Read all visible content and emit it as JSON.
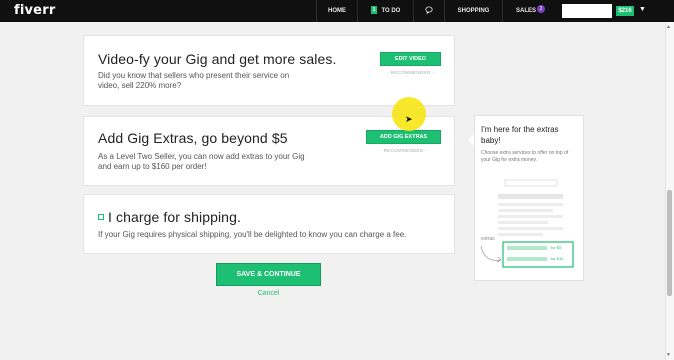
{
  "nav": {
    "logo": "fiverr",
    "home": "HOME",
    "todo_badge": "1",
    "todo": "TO DO",
    "shopping": "SHOPPING",
    "sales": "SALES",
    "sales_badge": "2",
    "balance": "$216"
  },
  "cards": {
    "video": {
      "title": "Video-fy your Gig and get more sales.",
      "body": "Did you know that sellers who present their service on video, sell 220% more?",
      "button": "EDIT VIDEO",
      "recommended": "- RECOMMENDED -"
    },
    "extras": {
      "title": "Add Gig Extras, go beyond $5",
      "body": "As a Level Two Seller, you can now add extras to your Gig and earn up to $160 per order!",
      "button": "ADD GIG EXTRAS",
      "recommended": "- RECOMMENDED -"
    },
    "shipping": {
      "title": "I charge for shipping.",
      "body": "If your Gig requires physical shipping, you'll be delighted to know you can charge a fee."
    }
  },
  "actions": {
    "save": "SAVE & CONTINUE",
    "cancel": "Cancel"
  },
  "tip": {
    "title": "I'm here for the extras baby!",
    "body": "Choose extra services to offer on top of your Gig for extra money.",
    "illustration_label": "extras",
    "price_1": "for $5",
    "price_2": "for $10"
  },
  "colors": {
    "accent": "#1dbf73",
    "topbar": "#101010",
    "badge_purple": "#7b3fbf"
  },
  "icons": {
    "chat": "speech-bubble-icon",
    "dropdown": "caret-down-icon",
    "checkbox": "checkbox-icon"
  }
}
